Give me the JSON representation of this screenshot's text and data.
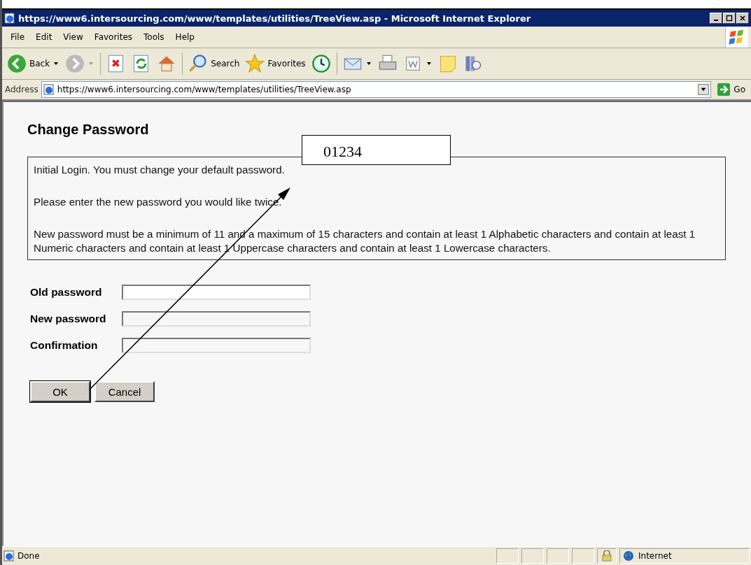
{
  "window": {
    "title": "https://www6.intersourcing.com/www/templates/utilities/TreeView.asp - Microsoft Internet Explorer"
  },
  "menu": [
    "File",
    "Edit",
    "View",
    "Favorites",
    "Tools",
    "Help"
  ],
  "toolbar": [
    {
      "kind": "back",
      "label": "Back"
    },
    {
      "kind": "forward"
    },
    {
      "kind": "stop"
    },
    {
      "kind": "refresh"
    },
    {
      "kind": "home"
    },
    {
      "kind": "search",
      "label": "Search"
    },
    {
      "kind": "favorites",
      "label": "Favorites"
    },
    {
      "kind": "history"
    },
    {
      "kind": "mail"
    },
    {
      "kind": "print"
    },
    {
      "kind": "word"
    },
    {
      "kind": "notes"
    },
    {
      "kind": "research"
    }
  ],
  "address": {
    "label": "Address",
    "url": "https://www6.intersourcing.com/www/templates/utilities/TreeView.asp",
    "go": "Go"
  },
  "page": {
    "heading": "Change Password",
    "info": [
      "Initial Login. You must change your default password.",
      "Please enter the new password you would like twice.",
      "New password must be a minimum of 11 and a maximum of 15 characters and contain at least 1 Alphabetic characters and contain at least 1 Numeric characters and contain at least 1 Uppercase characters and contain at least 1 Lowercase characters."
    ],
    "fields": [
      {
        "label": "Old password"
      },
      {
        "label": "New password"
      },
      {
        "label": "Confirmation"
      }
    ],
    "buttons": [
      "OK",
      "Cancel"
    ]
  },
  "annotation": {
    "label": "01234"
  },
  "status_bar": {
    "text": "Done",
    "zone": "Internet"
  }
}
